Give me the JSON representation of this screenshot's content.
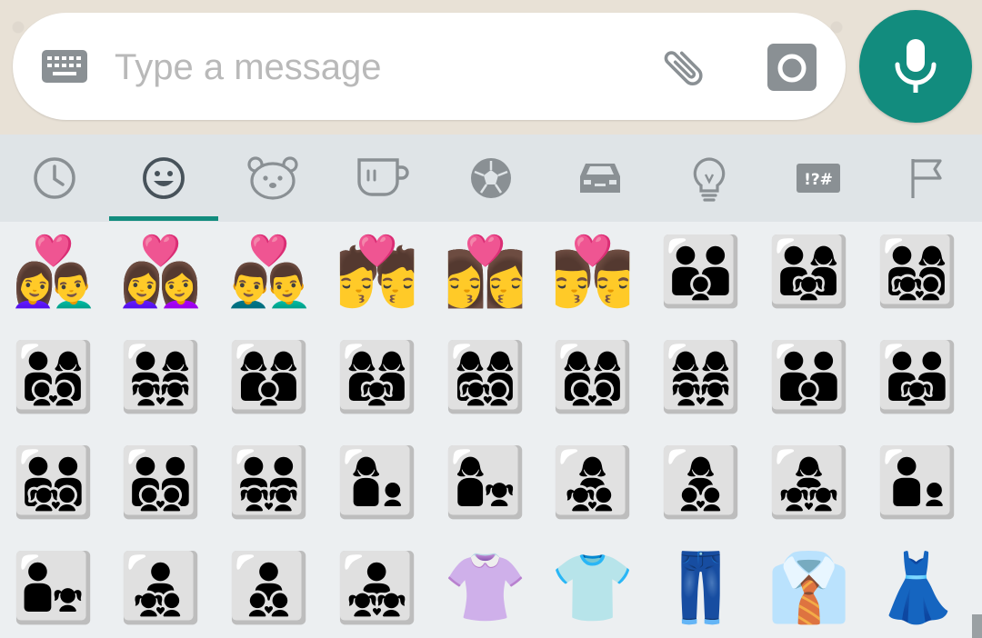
{
  "input_bar": {
    "placeholder": "Type a message",
    "value": ""
  },
  "icons": {
    "keyboard": "keyboard-icon",
    "attach": "paperclip-icon",
    "camera": "camera-icon",
    "send": "microphone-icon"
  },
  "colors": {
    "accent": "#128c7e",
    "icon_gray": "#8a9094",
    "tab_bg": "#dfe4e7",
    "grid_bg": "#eceff1"
  },
  "emoji_tabs": [
    {
      "name": "recent",
      "icon": "clock-icon",
      "selected": false
    },
    {
      "name": "smileys-people",
      "icon": "smiley-icon",
      "selected": true
    },
    {
      "name": "animals-nature",
      "icon": "bear-icon",
      "selected": false
    },
    {
      "name": "food-drink",
      "icon": "cup-icon",
      "selected": false
    },
    {
      "name": "activity",
      "icon": "soccer-ball-icon",
      "selected": false
    },
    {
      "name": "travel-places",
      "icon": "car-icon",
      "selected": false
    },
    {
      "name": "objects",
      "icon": "lightbulb-icon",
      "selected": false
    },
    {
      "name": "symbols",
      "icon": "symbols-icon",
      "label": "!?#",
      "selected": false
    },
    {
      "name": "flags",
      "icon": "flag-icon",
      "selected": false
    }
  ],
  "emoji_rows": [
    [
      "👩‍❤️‍👨",
      "👩‍❤️‍👩",
      "👨‍❤️‍👨",
      "💏",
      "👩‍❤️‍💋‍👩",
      "👨‍❤️‍💋‍👨",
      "👪",
      "👨‍👩‍👧",
      "👨‍👩‍👧‍👦"
    ],
    [
      "👨‍👩‍👦‍👦",
      "👨‍👩‍👧‍👧",
      "👩‍👩‍👦",
      "👩‍👩‍👧",
      "👩‍👩‍👧‍👦",
      "👩‍👩‍👦‍👦",
      "👩‍👩‍👧‍👧",
      "👨‍👨‍👦",
      "👨‍👨‍👧"
    ],
    [
      "👨‍👨‍👧‍👦",
      "👨‍👨‍👦‍👦",
      "👨‍👨‍👧‍👧",
      "👩‍👦",
      "👩‍👧",
      "👩‍👧‍👦",
      "👩‍👦‍👦",
      "👩‍👧‍👧",
      "👨‍👦"
    ],
    [
      "👨‍👧",
      "👨‍👧‍👦",
      "👨‍👦‍👦",
      "👨‍👧‍👧",
      "👚",
      "👕",
      "👖",
      "👔",
      "👗"
    ]
  ]
}
